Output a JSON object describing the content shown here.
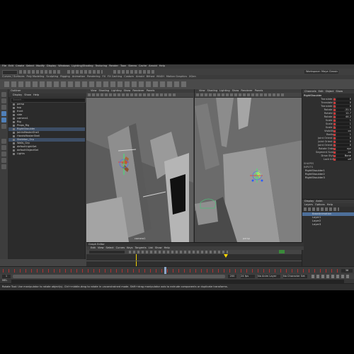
{
  "menubar": [
    "File",
    "Edit",
    "Create",
    "Select",
    "Modify",
    "Display",
    "Windows",
    "Lighting/Shading",
    "Texturing",
    "Render",
    "Toon",
    "Stereo",
    "Cache",
    "Arnold",
    "Help"
  ],
  "workspace_label": "Workspace: Maya Classic",
  "shelf_tabs": [
    "Curves / Surfaces",
    "Poly Modeling",
    "Sculpting",
    "Rigging",
    "Animation",
    "Rendering",
    "FX",
    "FX Caching",
    "Custom",
    "Arnold",
    "Bifrost",
    "MASH",
    "Motion Graphics",
    "XGen"
  ],
  "outliner": {
    "title": "Outliner",
    "menu": [
      "Display",
      "Show",
      "Help"
    ],
    "search_placeholder": "Search...",
    "items": [
      {
        "label": "persp",
        "selected": false
      },
      {
        "label": "top",
        "selected": false
      },
      {
        "label": "front",
        "selected": false
      },
      {
        "label": "side",
        "selected": false
      },
      {
        "label": "camera1",
        "selected": false
      },
      {
        "label": "Rig",
        "selected": false
      },
      {
        "label": "Props_Rig",
        "selected": false
      },
      {
        "label": "RightShoulder",
        "selected": true
      },
      {
        "label": "JointsMasterShell",
        "selected": false
      },
      {
        "label": "HandsMasterShell",
        "selected": false
      },
      {
        "label": "Skeleton_Grp",
        "selected": true
      },
      {
        "label": "Walls_Grp",
        "selected": false
      },
      {
        "label": "defaultLightSet",
        "selected": false
      },
      {
        "label": "defaultObjectSet",
        "selected": false
      },
      {
        "label": "Lights",
        "selected": false
      }
    ]
  },
  "viewport_menu": [
    "View",
    "Shading",
    "Lighting",
    "Show",
    "Renderer",
    "Panels"
  ],
  "viewport_left": {
    "camera_label": "camera1",
    "title": "persp"
  },
  "viewport_right": {
    "camera_label": "persp"
  },
  "channel_box": {
    "tabs": [
      "Channels",
      "Edit",
      "Object",
      "Show"
    ],
    "object": "RightShoulder",
    "channels": [
      {
        "name": "Translate X",
        "value": "0"
      },
      {
        "name": "Translate Y",
        "value": "0"
      },
      {
        "name": "Translate Z",
        "value": "0"
      },
      {
        "name": "Rotate X",
        "value": "-31.5"
      },
      {
        "name": "Rotate Y",
        "value": "12.7"
      },
      {
        "name": "Rotate Z",
        "value": "44.2"
      },
      {
        "name": "Scale X",
        "value": "1"
      },
      {
        "name": "Scale Y",
        "value": "1"
      },
      {
        "name": "Scale Z",
        "value": "1"
      },
      {
        "name": "Visibility",
        "value": "on"
      },
      {
        "name": "Radius",
        "value": "1"
      },
      {
        "name": "Joint Orient X",
        "value": "0"
      },
      {
        "name": "Joint Orient Y",
        "value": "0"
      },
      {
        "name": "Joint Orient Z",
        "value": "0"
      },
      {
        "name": "Rotate Order",
        "value": "xyz"
      },
      {
        "name": "Segment Scale",
        "value": "on"
      },
      {
        "name": "Draw Style",
        "value": "Bone"
      },
      {
        "name": "Lock Infl.",
        "value": "off"
      }
    ],
    "shapes_label": "SHAPES",
    "inputs_label": "INPUTS",
    "inputs": [
      "RightShoulder1",
      "RightShoulder2",
      "RightShoulder3"
    ]
  },
  "layer_editor": {
    "tabs": [
      "Display",
      "Anim"
    ],
    "menu": [
      "Layers",
      "Options",
      "Help"
    ],
    "layers": [
      {
        "label": "BaseAnimation",
        "selected": true
      },
      {
        "label": "Layer1",
        "selected": false
      },
      {
        "label": "Layer2",
        "selected": false
      },
      {
        "label": "Layer3",
        "selected": false
      }
    ]
  },
  "graph_editor": {
    "title": "Graph Editor",
    "menu": [
      "Edit",
      "View",
      "Select",
      "Curves",
      "Keys",
      "Tangents",
      "List",
      "Show",
      "Help"
    ],
    "stats_placeholder": "Stats"
  },
  "timeline": {
    "current_frame": "36",
    "start": "1",
    "end": "120",
    "playhead_fraction": 0.48
  },
  "range": {
    "start": "1",
    "end": "200",
    "fps": "24 fps",
    "anim_layer": "No Anim Layer",
    "char_set": "No Character Set"
  },
  "command_line": "MEL",
  "help_line": "Rotate Tool: Use manipulator to rotate object(s). Ctrl+middle-drag to rotate in unconstrained mode. Shift+drag manipulator axis to extrude components or duplicate transforms.",
  "colors": {
    "accent": "#4b7dc0",
    "key": "#c63b3b",
    "playhead": "#f5d400",
    "selection": "#3d4e66"
  }
}
